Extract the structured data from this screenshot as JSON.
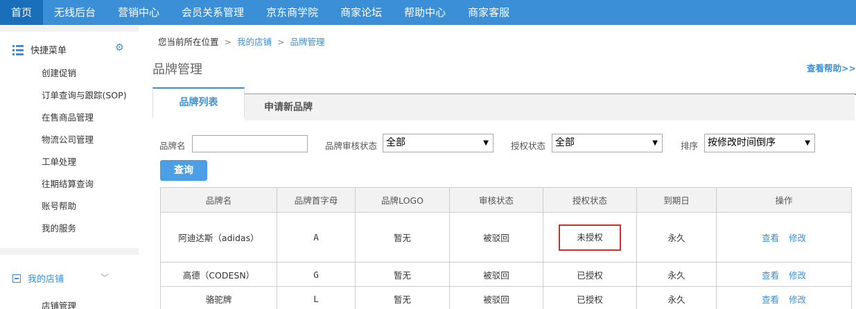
{
  "topnav": [
    {
      "label": "首页",
      "active": true
    },
    {
      "label": "无线后台"
    },
    {
      "label": "营销中心"
    },
    {
      "label": "会员关系管理"
    },
    {
      "label": "京东商学院"
    },
    {
      "label": "商家论坛"
    },
    {
      "label": "帮助中心"
    },
    {
      "label": "商家客服"
    }
  ],
  "sidebar": {
    "quick_menu": {
      "title": "快捷菜单",
      "items": [
        "创建促销",
        "订单查询与跟踪(SOP)",
        "在售商品管理",
        "物流公司管理",
        "工单处理",
        "往期结算查询",
        "账号帮助",
        "我的服务"
      ]
    },
    "my_shop": {
      "title": "我的店铺",
      "items": [
        "店铺管理"
      ]
    }
  },
  "breadcrumb": {
    "prefix": "您当前所在位置",
    "sep": ">",
    "items": [
      "我的店铺",
      "品牌管理"
    ]
  },
  "page": {
    "title": "品牌管理",
    "help": "查看帮助>>"
  },
  "tabs": [
    "品牌列表",
    "申请新品牌"
  ],
  "filters": {
    "brand_name_label": "品牌名",
    "brand_name_value": "",
    "review_label": "品牌审核状态",
    "review_value": "全部",
    "auth_label": "授权状态",
    "auth_value": "全部",
    "sort_label": "排序",
    "sort_value": "按修改时间倒序",
    "query_button": "查询"
  },
  "table": {
    "headers": [
      "品牌名",
      "品牌首字母",
      "品牌LOGO",
      "审核状态",
      "授权状态",
      "到期日",
      "操作"
    ],
    "rows": [
      {
        "name": "阿迪达斯（adidas）",
        "letter": "A",
        "logo": "暂无",
        "review": "被驳回",
        "auth": "未授权",
        "expire": "永久",
        "view": "查看",
        "edit": "修改"
      },
      {
        "name": "高德（CODESN）",
        "letter": "G",
        "logo": "暂无",
        "review": "被驳回",
        "auth": "已授权",
        "expire": "永久",
        "view": "查看",
        "edit": "修改"
      },
      {
        "name": "骆驼牌",
        "letter": "L",
        "logo": "暂无",
        "review": "被驳回",
        "auth": "已授权",
        "expire": "永久",
        "view": "查看",
        "edit": "修改"
      }
    ]
  },
  "colors": {
    "nav_bg": "#3b8fd6",
    "nav_active": "#1a6fba",
    "link": "#3b8fd6",
    "highlight_border": "#d42b2b"
  }
}
